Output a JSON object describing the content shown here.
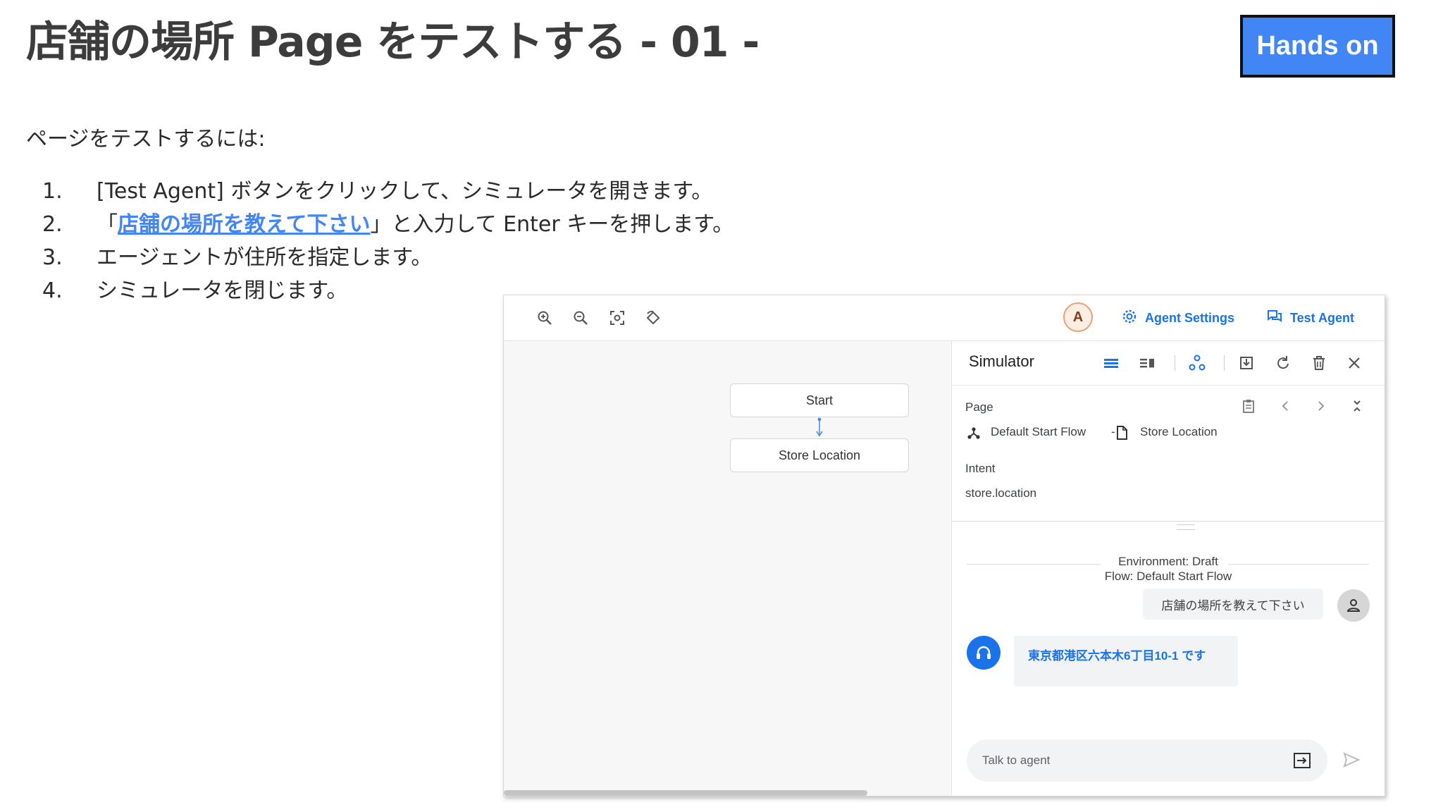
{
  "slide": {
    "title": "店舗の場所 Page をテストする - 01 -",
    "badge": "Hands on",
    "intro": "ページをテストするには:",
    "steps": [
      {
        "num": "1.",
        "text": "[Test Agent] ボタンをクリックして、シミュレータを開きます。"
      },
      {
        "num": "2.",
        "prefix": "「",
        "link": "店舗の場所を教えて下さい",
        "suffix": "」と入力して Enter キーを押します。"
      },
      {
        "num": "3.",
        "text": "エージェントが住所を指定します。"
      },
      {
        "num": "4.",
        "text": "シミュレータを閉じます。"
      }
    ]
  },
  "console": {
    "toolbar": {
      "icons": [
        "zoom-in-icon",
        "zoom-out-icon",
        "fit-screen-icon",
        "reset-rotate-icon"
      ],
      "avatar": "A",
      "agent_settings": "Agent Settings",
      "test_agent": "Test Agent"
    },
    "canvas": {
      "nodes": [
        "Start",
        "Store Location"
      ]
    },
    "simulator": {
      "title": "Simulator",
      "page_label": "Page",
      "flow_name": "Default Start Flow",
      "flow_sep": "-",
      "page_name": "Store Location",
      "intent_label": "Intent",
      "intent_value": "store.location",
      "environment": "Environment: Draft",
      "flow_info": "Flow: Default Start Flow",
      "user_message": "店舗の場所を教えて下さい",
      "agent_message": "東京都港区六本木6丁目10-1 です",
      "input_placeholder": "Talk to agent"
    },
    "colors": {
      "accent": "#1a73e8",
      "badge": "#4285f4"
    }
  }
}
